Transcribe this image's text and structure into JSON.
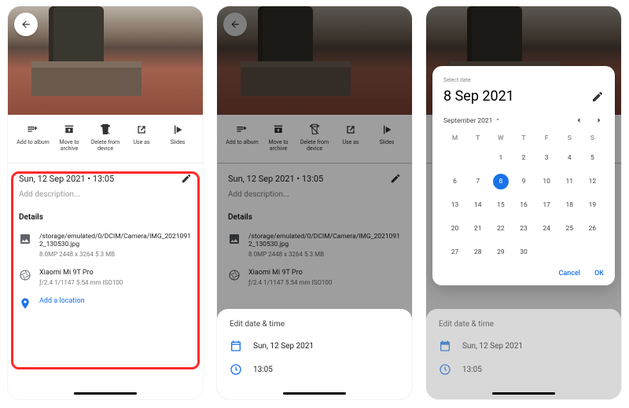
{
  "info": {
    "datetime": "Sun, 12 Sep 2021 • 13:05",
    "desc_placeholder": "Add description...",
    "details_title": "Details",
    "path": "/storage/emulated/0/DCIM/Camera/IMG_20210912_130530.jpg",
    "file_meta": "8.0MP   2448 x 3264   5.3 MB",
    "device": "Xiaomi Mi 9T Pro",
    "device_meta": "ƒ/2.4   1/1147   5.54 mm   ISO100",
    "add_location": "Add a location"
  },
  "toolbar": {
    "items": [
      {
        "label": "Add to album"
      },
      {
        "label": "Move to archive"
      },
      {
        "label": "Delete from device"
      },
      {
        "label": "Use as"
      },
      {
        "label": "Slides"
      }
    ]
  },
  "editsheet": {
    "title": "Edit date & time",
    "date": "Sun, 12 Sep 2021",
    "time": "13:05"
  },
  "datepicker": {
    "select_label": "Select date",
    "picked": "8 Sep 2021",
    "month_label": "September 2021",
    "dow": [
      "M",
      "T",
      "W",
      "T",
      "F",
      "S",
      "S"
    ],
    "days": [
      "",
      "",
      "1",
      "2",
      "3",
      "4",
      "5",
      "6",
      "7",
      "8",
      "9",
      "10",
      "11",
      "12",
      "13",
      "14",
      "15",
      "16",
      "17",
      "18",
      "19",
      "20",
      "21",
      "22",
      "23",
      "24",
      "25",
      "26",
      "27",
      "28",
      "29",
      "30",
      "",
      "",
      ""
    ],
    "selected_index": 9,
    "cancel": "Cancel",
    "ok": "OK"
  }
}
